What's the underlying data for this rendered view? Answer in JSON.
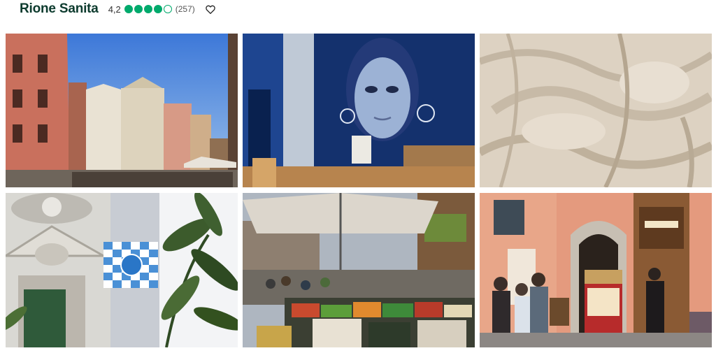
{
  "place": {
    "name": "Rione Sanita",
    "rating": "4,2",
    "bubbles_filled": 4,
    "bubbles_total": 5,
    "review_count": "(257)"
  },
  "icons": {
    "favorite": "heart-icon"
  },
  "colors": {
    "title": "#0d3b2e",
    "rating_bubble": "#00aa6c"
  },
  "photos": [
    {
      "subject": "street-buildings"
    },
    {
      "subject": "mural-woman-face"
    },
    {
      "subject": "marble-sculpture-relief"
    },
    {
      "subject": "blue-checkered-flag-facade"
    },
    {
      "subject": "street-market-stalls"
    },
    {
      "subject": "street-shop-entrance"
    }
  ]
}
